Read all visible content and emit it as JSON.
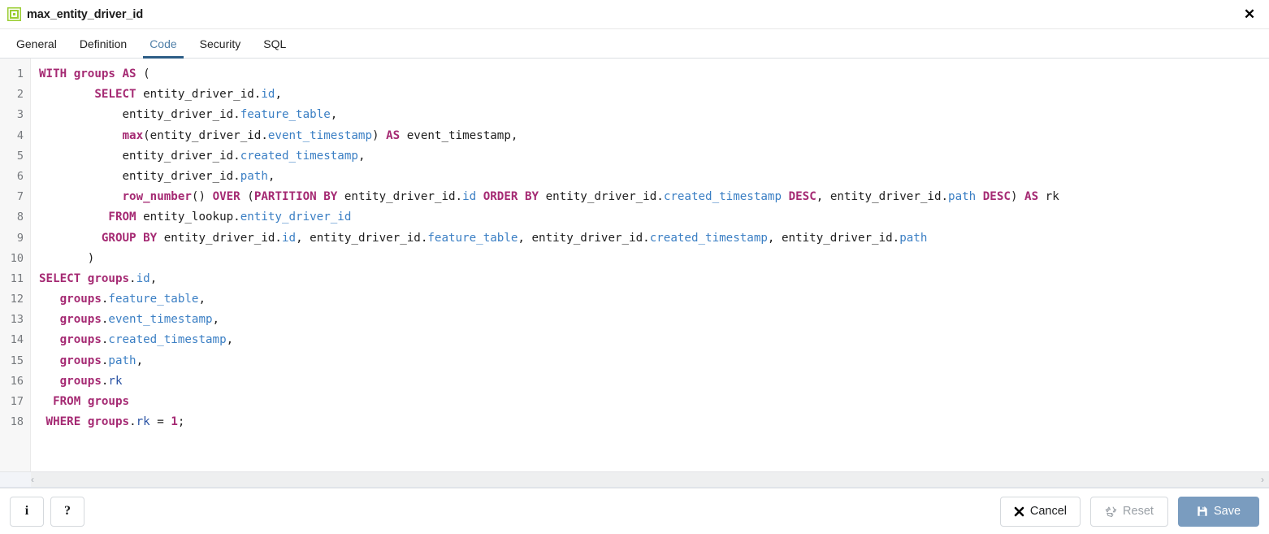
{
  "window": {
    "title": "max_entity_driver_id",
    "icon": "materialized-view-icon",
    "close_label": "✕"
  },
  "tabs": [
    {
      "label": "General",
      "active": false
    },
    {
      "label": "Definition",
      "active": false
    },
    {
      "label": "Code",
      "active": true
    },
    {
      "label": "Security",
      "active": false
    },
    {
      "label": "SQL",
      "active": false
    }
  ],
  "editor": {
    "language": "sql",
    "line_numbers": [
      1,
      2,
      3,
      4,
      5,
      6,
      7,
      8,
      9,
      10,
      11,
      12,
      13,
      14,
      15,
      16,
      17,
      18
    ],
    "lines": [
      "WITH groups AS (",
      "        SELECT entity_driver_id.id,",
      "            entity_driver_id.feature_table,",
      "            max(entity_driver_id.event_timestamp) AS event_timestamp,",
      "            entity_driver_id.created_timestamp,",
      "            entity_driver_id.path,",
      "            row_number() OVER (PARTITION BY entity_driver_id.id ORDER BY entity_driver_id.created_timestamp DESC, entity_driver_id.path DESC) AS rk",
      "          FROM entity_lookup.entity_driver_id",
      "         GROUP BY entity_driver_id.id, entity_driver_id.feature_table, entity_driver_id.created_timestamp, entity_driver_id.path",
      "       )",
      "SELECT groups.id,",
      "   groups.feature_table,",
      "   groups.event_timestamp,",
      "   groups.created_timestamp,",
      "   groups.path,",
      "   groups.rk",
      "  FROM groups",
      " WHERE groups.rk = 1;"
    ],
    "tokens": [
      [
        [
          "kw",
          "WITH"
        ],
        [
          "pln",
          " "
        ],
        [
          "kw",
          "groups"
        ],
        [
          "pln",
          " "
        ],
        [
          "kw",
          "AS"
        ],
        [
          "pln",
          " "
        ],
        [
          "punct",
          "("
        ]
      ],
      [
        [
          "pln",
          "        "
        ],
        [
          "kw",
          "SELECT"
        ],
        [
          "pln",
          " entity_driver_id."
        ],
        [
          "col",
          "id"
        ],
        [
          "punct",
          ","
        ]
      ],
      [
        [
          "pln",
          "            entity_driver_id."
        ],
        [
          "col",
          "feature_table"
        ],
        [
          "punct",
          ","
        ]
      ],
      [
        [
          "pln",
          "            "
        ],
        [
          "fn",
          "max"
        ],
        [
          "punct",
          "("
        ],
        [
          "pln",
          "entity_driver_id."
        ],
        [
          "col",
          "event_timestamp"
        ],
        [
          "punct",
          ")"
        ],
        [
          "pln",
          " "
        ],
        [
          "kw",
          "AS"
        ],
        [
          "pln",
          " event_timestamp"
        ],
        [
          "punct",
          ","
        ]
      ],
      [
        [
          "pln",
          "            entity_driver_id."
        ],
        [
          "col",
          "created_timestamp"
        ],
        [
          "punct",
          ","
        ]
      ],
      [
        [
          "pln",
          "            entity_driver_id."
        ],
        [
          "col",
          "path"
        ],
        [
          "punct",
          ","
        ]
      ],
      [
        [
          "pln",
          "            "
        ],
        [
          "fn",
          "row_number"
        ],
        [
          "punct",
          "()"
        ],
        [
          "pln",
          " "
        ],
        [
          "kw",
          "OVER"
        ],
        [
          "pln",
          " "
        ],
        [
          "punct",
          "("
        ],
        [
          "kw",
          "PARTITION BY"
        ],
        [
          "pln",
          " entity_driver_id."
        ],
        [
          "col",
          "id"
        ],
        [
          "pln",
          " "
        ],
        [
          "kw",
          "ORDER BY"
        ],
        [
          "pln",
          " entity_driver_id."
        ],
        [
          "col",
          "created_timestamp"
        ],
        [
          "pln",
          " "
        ],
        [
          "kw",
          "DESC"
        ],
        [
          "punct",
          ","
        ],
        [
          "pln",
          " entity_driver_id."
        ],
        [
          "col",
          "path"
        ],
        [
          "pln",
          " "
        ],
        [
          "kw",
          "DESC"
        ],
        [
          "punct",
          ")"
        ],
        [
          "pln",
          " "
        ],
        [
          "kw",
          "AS"
        ],
        [
          "pln",
          " rk"
        ]
      ],
      [
        [
          "pln",
          "          "
        ],
        [
          "kw",
          "FROM"
        ],
        [
          "pln",
          " entity_lookup."
        ],
        [
          "col",
          "entity_driver_id"
        ]
      ],
      [
        [
          "pln",
          "         "
        ],
        [
          "kw",
          "GROUP BY"
        ],
        [
          "pln",
          " entity_driver_id."
        ],
        [
          "col",
          "id"
        ],
        [
          "punct",
          ","
        ],
        [
          "pln",
          " entity_driver_id."
        ],
        [
          "col",
          "feature_table"
        ],
        [
          "punct",
          ","
        ],
        [
          "pln",
          " entity_driver_id."
        ],
        [
          "col",
          "created_timestamp"
        ],
        [
          "punct",
          ","
        ],
        [
          "pln",
          " entity_driver_id."
        ],
        [
          "col",
          "path"
        ]
      ],
      [
        [
          "pln",
          "       "
        ],
        [
          "punct",
          ")"
        ]
      ],
      [
        [
          "kw",
          "SELECT"
        ],
        [
          "pln",
          " "
        ],
        [
          "kw",
          "groups"
        ],
        [
          "punct",
          "."
        ],
        [
          "col",
          "id"
        ],
        [
          "punct",
          ","
        ]
      ],
      [
        [
          "pln",
          "   "
        ],
        [
          "kw",
          "groups"
        ],
        [
          "punct",
          "."
        ],
        [
          "col",
          "feature_table"
        ],
        [
          "punct",
          ","
        ]
      ],
      [
        [
          "pln",
          "   "
        ],
        [
          "kw",
          "groups"
        ],
        [
          "punct",
          "."
        ],
        [
          "col",
          "event_timestamp"
        ],
        [
          "punct",
          ","
        ]
      ],
      [
        [
          "pln",
          "   "
        ],
        [
          "kw",
          "groups"
        ],
        [
          "punct",
          "."
        ],
        [
          "col",
          "created_timestamp"
        ],
        [
          "punct",
          ","
        ]
      ],
      [
        [
          "pln",
          "   "
        ],
        [
          "kw",
          "groups"
        ],
        [
          "punct",
          "."
        ],
        [
          "col",
          "path"
        ],
        [
          "punct",
          ","
        ]
      ],
      [
        [
          "pln",
          "   "
        ],
        [
          "kw",
          "groups"
        ],
        [
          "punct",
          "."
        ],
        [
          "col2",
          "rk"
        ]
      ],
      [
        [
          "pln",
          "  "
        ],
        [
          "kw",
          "FROM"
        ],
        [
          "pln",
          " "
        ],
        [
          "kw",
          "groups"
        ]
      ],
      [
        [
          "pln",
          " "
        ],
        [
          "kw",
          "WHERE"
        ],
        [
          "pln",
          " "
        ],
        [
          "kw",
          "groups"
        ],
        [
          "punct",
          "."
        ],
        [
          "col2",
          "rk"
        ],
        [
          "pln",
          " "
        ],
        [
          "punct",
          "="
        ],
        [
          "pln",
          " "
        ],
        [
          "num",
          "1"
        ],
        [
          "punct",
          ";"
        ]
      ]
    ]
  },
  "scrollbar": {
    "left_arrow": "‹",
    "right_arrow": "›"
  },
  "footer": {
    "info_label": "i",
    "help_label": "?",
    "cancel_label": "Cancel",
    "cancel_icon": "✖",
    "reset_label": "Reset",
    "reset_icon": "recycle-icon",
    "save_label": "Save",
    "save_icon": "floppy-disk-icon"
  },
  "colors": {
    "keyword": "#a52a73",
    "column": "#3b7fc4",
    "column_alt": "#2952a3",
    "plain": "#202020",
    "tab_active": "#4f7fa8",
    "tab_underline": "#2c5d86",
    "save_bg": "#7a9cbf",
    "icon_green": "#9acd32",
    "gutter_bg": "#f7f7f7"
  }
}
